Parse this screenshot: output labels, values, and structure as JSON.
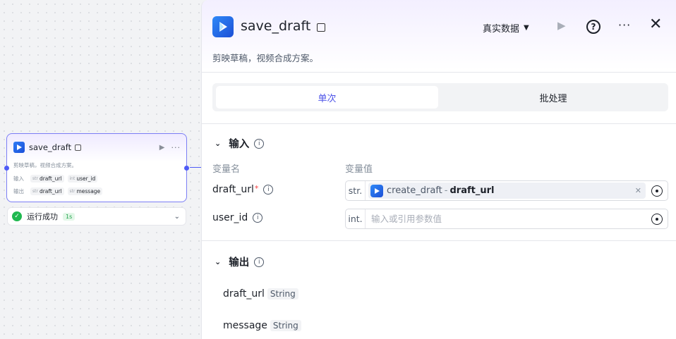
{
  "node": {
    "title": "save_draft",
    "description": "剪映草稿，视频合成方案。",
    "inputs_label": "输入",
    "outputs_label": "输出",
    "inputs": [
      {
        "type": "str",
        "name": "draft_url"
      },
      {
        "type": "int",
        "name": "user_id"
      }
    ],
    "outputs": [
      {
        "type": "str",
        "name": "draft_url"
      },
      {
        "type": "str",
        "name": "message"
      }
    ],
    "status_text": "运行成功",
    "status_time": "1s"
  },
  "panel": {
    "title": "save_draft",
    "data_select": "真实数据",
    "description": "剪映草稿，视频合成方案。",
    "tabs": {
      "single": "单次",
      "batch": "批处理"
    },
    "input_section": "输入",
    "col_name": "变量名",
    "col_value": "变量值",
    "params": [
      {
        "name": "draft_url",
        "required": "*",
        "type": "str.",
        "ref_source": "create_draft",
        "ref_sep": "-",
        "ref_var": "draft_url"
      },
      {
        "name": "user_id",
        "type": "int.",
        "placeholder": "输入或引用参数值"
      }
    ],
    "output_section": "输出",
    "outputs": [
      {
        "name": "draft_url",
        "type": "String"
      },
      {
        "name": "message",
        "type": "String"
      }
    ]
  },
  "icons": {
    "app_logo": "play-logo-icon",
    "save": "save-icon",
    "info": "info-icon",
    "help": "help-icon",
    "close": "close-icon"
  },
  "colors": {
    "accent": "#4d53e8",
    "node_border": "#7b7ef5",
    "success": "#1fb84f",
    "required": "#f53f3f"
  }
}
